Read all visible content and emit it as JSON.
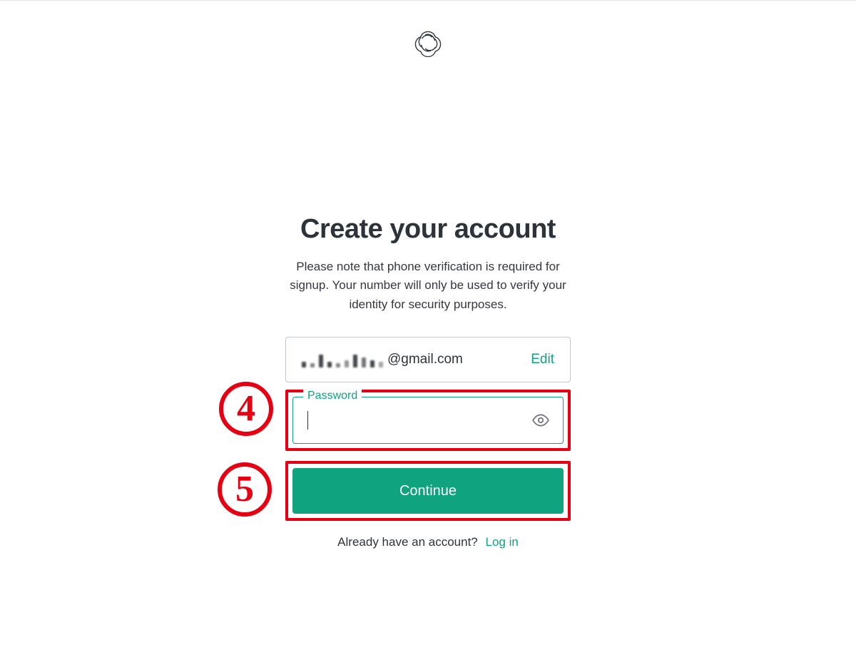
{
  "header": {
    "logo_name": "openai-logo"
  },
  "form": {
    "title": "Create your account",
    "subtitle": "Please note that phone verification is required for signup. Your number will only be used to verify your identity for security purposes.",
    "email": {
      "masked_local_part": "(blurred)",
      "domain_suffix": "@gmail.com",
      "edit_label": "Edit"
    },
    "password": {
      "label": "Password",
      "value": "",
      "placeholder": ""
    },
    "continue_label": "Continue",
    "already_text": "Already have an account?",
    "login_label": "Log in"
  },
  "annotations": {
    "step4": "4",
    "step5": "5"
  },
  "colors": {
    "accent": "#10a37f",
    "annotation": "#e60012",
    "text": "#2d333a",
    "border": "#c2c8d0"
  }
}
